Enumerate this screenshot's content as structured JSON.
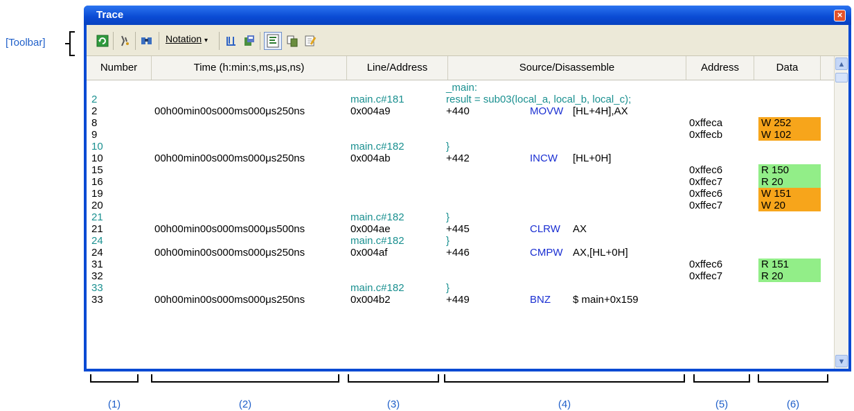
{
  "callouts": {
    "toolbar": "[Toolbar]",
    "columns": [
      "(1)",
      "(2)",
      "(3)",
      "(4)",
      "(5)",
      "(6)"
    ]
  },
  "window": {
    "title": "Trace",
    "close_icon": "close-icon"
  },
  "toolbar": {
    "items": [
      "refresh-icon",
      "clear-icon",
      "search-icon",
      "notation-dropdown",
      "window-icon",
      "save-icon",
      "mixed-display-icon",
      "copy-icon",
      "edit-icon"
    ],
    "notation_label": "Notation"
  },
  "columns": [
    "Number",
    "Time (h:min:s,ms,μs,ns)",
    "Line/Address",
    "Source/Disassemble",
    "Address",
    "Data"
  ],
  "rows": [
    {
      "number": "",
      "time": "",
      "line": "",
      "source": "_main:",
      "mnem": "",
      "operand": "",
      "address": "",
      "data": "",
      "kind": "src"
    },
    {
      "number": "2",
      "time": "",
      "line": "main.c#181",
      "source": "result = sub03(local_a, local_b, local_c);",
      "mnem": "",
      "operand": "",
      "address": "",
      "data": "",
      "kind": "src"
    },
    {
      "number": "2",
      "time": "00h00min00s000ms000μs250ns",
      "line": "0x004a9",
      "source": "+440",
      "mnem": "MOVW",
      "operand": "[HL+4H],AX",
      "address": "",
      "data": "",
      "kind": "asm"
    },
    {
      "number": "8",
      "time": "",
      "line": "",
      "source": "",
      "mnem": "",
      "operand": "",
      "address": "0xffeca",
      "data": "W 252",
      "kind": "asm"
    },
    {
      "number": "9",
      "time": "",
      "line": "",
      "source": "",
      "mnem": "",
      "operand": "",
      "address": "0xffecb",
      "data": "W 102",
      "kind": "asm"
    },
    {
      "number": "10",
      "time": "",
      "line": "main.c#182",
      "source": "}",
      "mnem": "",
      "operand": "",
      "address": "",
      "data": "",
      "kind": "src"
    },
    {
      "number": "10",
      "time": "00h00min00s000ms000μs250ns",
      "line": "0x004ab",
      "source": "+442",
      "mnem": "INCW",
      "operand": "[HL+0H]",
      "address": "",
      "data": "",
      "kind": "asm"
    },
    {
      "number": "15",
      "time": "",
      "line": "",
      "source": "",
      "mnem": "",
      "operand": "",
      "address": "0xffec6",
      "data": "R 150",
      "kind": "asm"
    },
    {
      "number": "16",
      "time": "",
      "line": "",
      "source": "",
      "mnem": "",
      "operand": "",
      "address": "0xffec7",
      "data": "R 20",
      "kind": "asm"
    },
    {
      "number": "19",
      "time": "",
      "line": "",
      "source": "",
      "mnem": "",
      "operand": "",
      "address": "0xffec6",
      "data": "W 151",
      "kind": "asm"
    },
    {
      "number": "20",
      "time": "",
      "line": "",
      "source": "",
      "mnem": "",
      "operand": "",
      "address": "0xffec7",
      "data": "W 20",
      "kind": "asm"
    },
    {
      "number": "21",
      "time": "",
      "line": "main.c#182",
      "source": "}",
      "mnem": "",
      "operand": "",
      "address": "",
      "data": "",
      "kind": "src"
    },
    {
      "number": "21",
      "time": "00h00min00s000ms000μs500ns",
      "line": "0x004ae",
      "source": "+445",
      "mnem": "CLRW",
      "operand": "AX",
      "address": "",
      "data": "",
      "kind": "asm"
    },
    {
      "number": "24",
      "time": "",
      "line": "main.c#182",
      "source": "}",
      "mnem": "",
      "operand": "",
      "address": "",
      "data": "",
      "kind": "src"
    },
    {
      "number": "24",
      "time": "00h00min00s000ms000μs250ns",
      "line": "0x004af",
      "source": "+446",
      "mnem": "CMPW",
      "operand": "AX,[HL+0H]",
      "address": "",
      "data": "",
      "kind": "asm"
    },
    {
      "number": "31",
      "time": "",
      "line": "",
      "source": "",
      "mnem": "",
      "operand": "",
      "address": "0xffec6",
      "data": "R 151",
      "kind": "asm"
    },
    {
      "number": "32",
      "time": "",
      "line": "",
      "source": "",
      "mnem": "",
      "operand": "",
      "address": "0xffec7",
      "data": "R 20",
      "kind": "asm"
    },
    {
      "number": "33",
      "time": "",
      "line": "main.c#182",
      "source": "}",
      "mnem": "",
      "operand": "",
      "address": "",
      "data": "",
      "kind": "src"
    },
    {
      "number": "33",
      "time": "00h00min00s000ms000μs250ns",
      "line": "0x004b2",
      "source": "+449",
      "mnem": "BNZ",
      "operand": "$ main+0x159",
      "address": "",
      "data": "",
      "kind": "asm"
    }
  ],
  "colors": {
    "write": "#f7a51b",
    "read": "#92ee88",
    "source_text": "#1a9090",
    "mnemonic": "#1a2fd2"
  }
}
